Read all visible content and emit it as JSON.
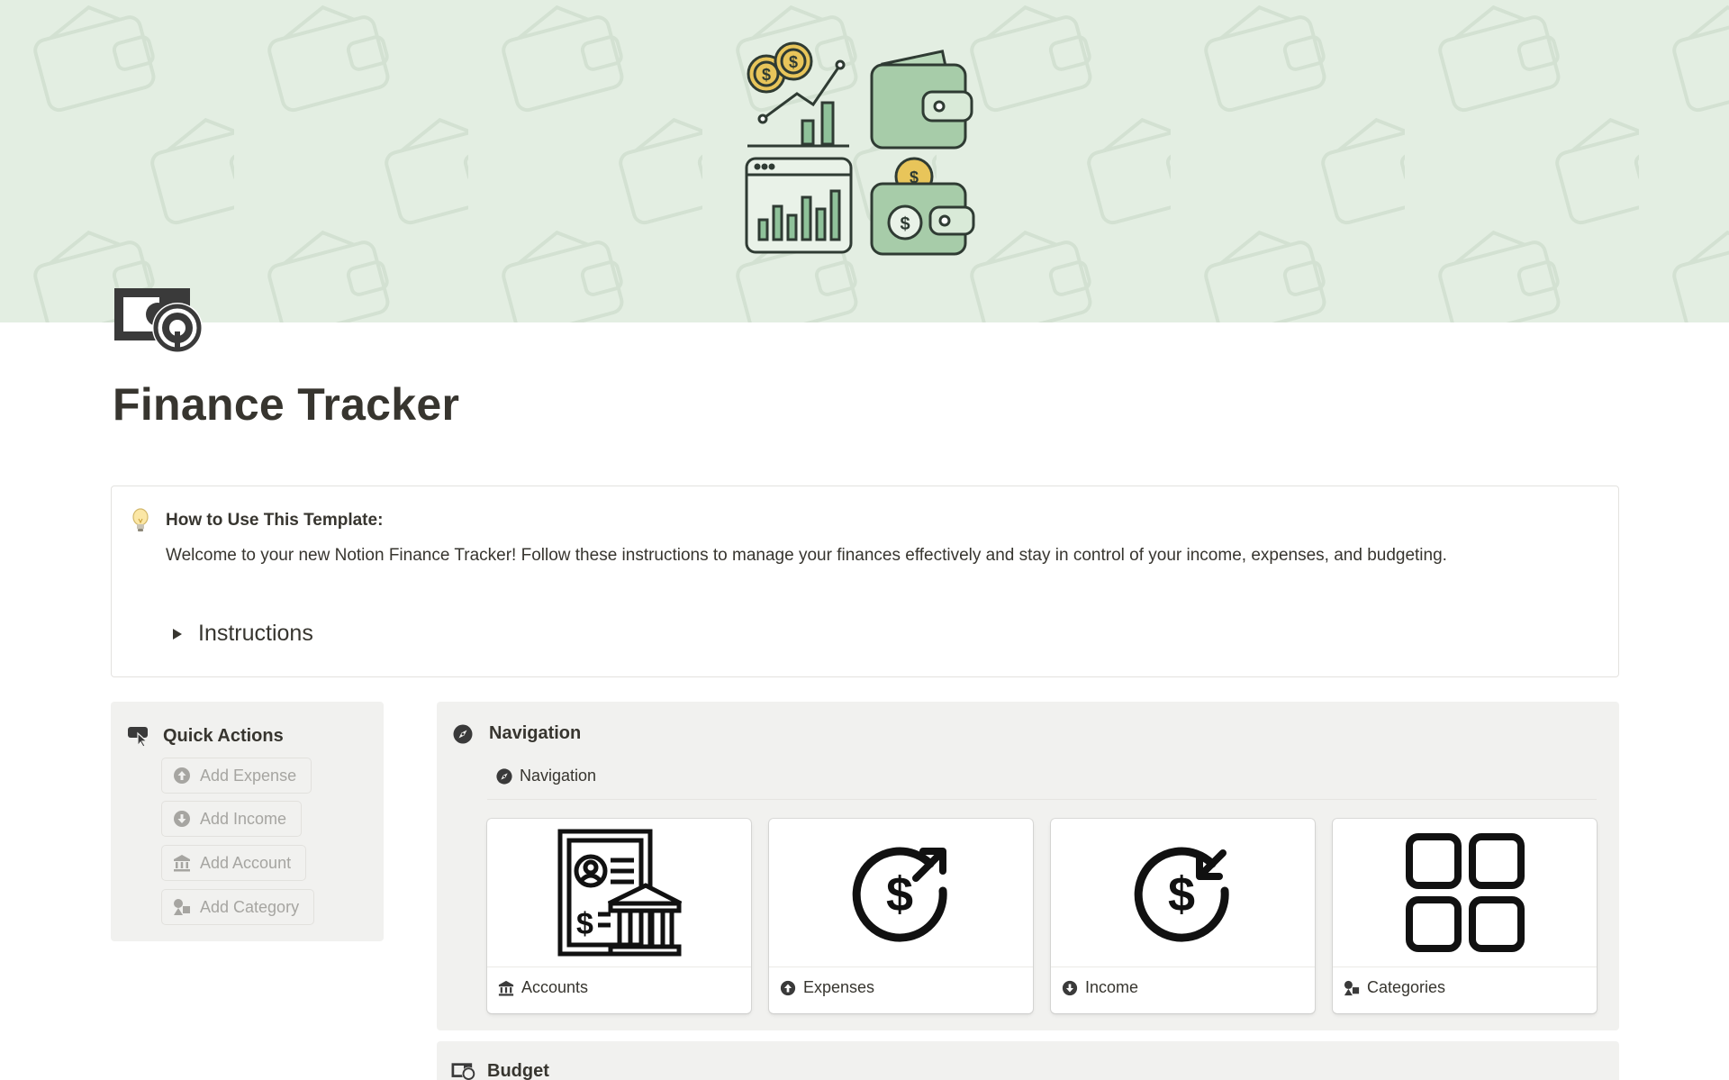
{
  "page": {
    "title": "Finance Tracker"
  },
  "callout": {
    "title": "How to Use This Template:",
    "body": "Welcome to your new Notion Finance Tracker! Follow these instructions to manage your finances effectively and stay in control of your income, expenses, and budgeting.",
    "toggle_label": "Instructions"
  },
  "quick_actions": {
    "title": "Quick Actions",
    "buttons": [
      {
        "label": "Add Expense",
        "icon": "arrow-up-circle-icon"
      },
      {
        "label": "Add Income",
        "icon": "arrow-down-circle-icon"
      },
      {
        "label": "Add Account",
        "icon": "bank-icon"
      },
      {
        "label": "Add Category",
        "icon": "shapes-icon"
      }
    ]
  },
  "navigation": {
    "title": "Navigation",
    "tab_label": "Navigation",
    "cards": [
      {
        "label": "Accounts",
        "icon": "bank-icon"
      },
      {
        "label": "Expenses",
        "icon": "arrow-up-circle-icon"
      },
      {
        "label": "Income",
        "icon": "arrow-down-circle-icon"
      },
      {
        "label": "Categories",
        "icon": "shapes-icon"
      }
    ]
  },
  "budget": {
    "title": "Budget"
  },
  "colors": {
    "cover_bg": "#e3eee2",
    "panel_bg": "#f1f1ef",
    "text": "#37352f",
    "muted_text": "#a6a5a1",
    "art_green": "#8fc29a"
  }
}
